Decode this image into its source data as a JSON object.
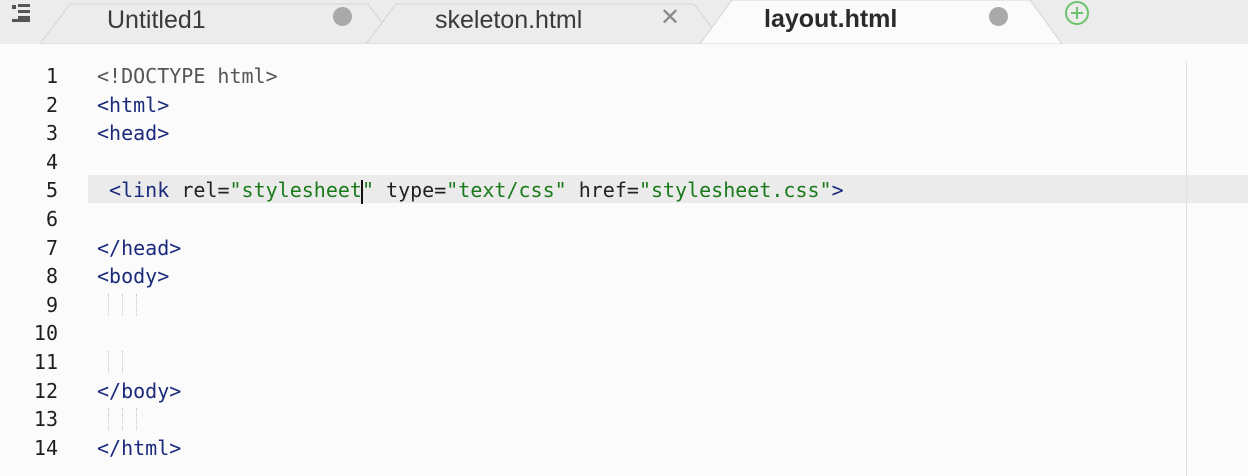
{
  "tabs": [
    {
      "label": "Untitled1",
      "state": "modified",
      "active": false
    },
    {
      "label": "skeleton.html",
      "state": "close",
      "active": false
    },
    {
      "label": "layout.html",
      "state": "modified",
      "active": true
    }
  ],
  "icons": {
    "menu": "menu-icon",
    "add": "plus-circle-icon",
    "close": "close-icon",
    "modified": "modified-dot-icon"
  },
  "colors": {
    "tag": "#1b2a7a",
    "string": "#1a7a1a",
    "add_icon": "#6cc36c"
  },
  "editor": {
    "current_line": 5,
    "line_numbers": [
      "1",
      "2",
      "3",
      "4",
      "5",
      "6",
      "7",
      "8",
      "9",
      "10",
      "11",
      "12",
      "13",
      "14"
    ],
    "lines": [
      {
        "tokens": [
          {
            "t": "doctype",
            "v": "<!DOCTYPE html>"
          }
        ]
      },
      {
        "tokens": [
          {
            "t": "tag",
            "v": "<html>"
          }
        ]
      },
      {
        "tokens": [
          {
            "t": "tag",
            "v": "<head>"
          }
        ]
      },
      {
        "tokens": []
      },
      {
        "tokens": [
          {
            "t": "plain",
            "v": " "
          },
          {
            "t": "tag",
            "v": "<link"
          },
          {
            "t": "plain",
            "v": " "
          },
          {
            "t": "attr",
            "v": "rel"
          },
          {
            "t": "eq",
            "v": "="
          },
          {
            "t": "str",
            "v": "\"stylesheet"
          },
          {
            "t": "cursor",
            "v": ""
          },
          {
            "t": "str",
            "v": "\""
          },
          {
            "t": "plain",
            "v": " "
          },
          {
            "t": "attr",
            "v": "type"
          },
          {
            "t": "eq",
            "v": "="
          },
          {
            "t": "str",
            "v": "\"text/css\""
          },
          {
            "t": "plain",
            "v": " "
          },
          {
            "t": "attr",
            "v": "href"
          },
          {
            "t": "eq",
            "v": "="
          },
          {
            "t": "str",
            "v": "\"stylesheet.css\""
          },
          {
            "t": "tag",
            "v": ">"
          }
        ]
      },
      {
        "tokens": []
      },
      {
        "tokens": [
          {
            "t": "tag",
            "v": "</head>"
          }
        ]
      },
      {
        "tokens": [
          {
            "t": "tag",
            "v": "<body>"
          }
        ]
      },
      {
        "tokens": []
      },
      {
        "tokens": []
      },
      {
        "tokens": []
      },
      {
        "tokens": [
          {
            "t": "tag",
            "v": "</body>"
          }
        ]
      },
      {
        "tokens": []
      },
      {
        "tokens": [
          {
            "t": "tag",
            "v": "</html>"
          }
        ]
      }
    ]
  }
}
